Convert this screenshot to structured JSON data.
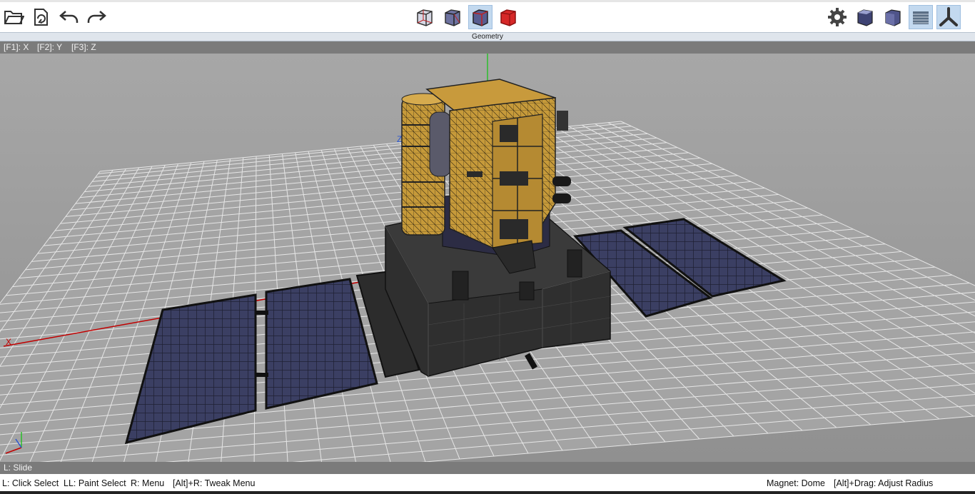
{
  "toolbar": {
    "left_tools": [
      {
        "name": "open-icon",
        "label": "Open"
      },
      {
        "name": "import-icon",
        "label": "Import"
      },
      {
        "name": "undo-icon",
        "label": "Undo"
      },
      {
        "name": "redo-icon",
        "label": "Redo"
      }
    ],
    "view_modes": [
      {
        "name": "wireframe-mode",
        "active": false
      },
      {
        "name": "wireframe-faces-mode",
        "active": false
      },
      {
        "name": "shaded-wireframe-mode",
        "active": true
      },
      {
        "name": "solid-mode",
        "active": false
      }
    ],
    "right_tools": [
      {
        "name": "settings-icon",
        "active": false
      },
      {
        "name": "cube-shaded-icon",
        "active": false
      },
      {
        "name": "cube-flat-icon",
        "active": false
      },
      {
        "name": "grid-plane-icon",
        "active": true
      },
      {
        "name": "axes-gizmo-icon",
        "active": true
      }
    ],
    "colors": {
      "accent": "#c3d9ef",
      "solid_red": "#d62828"
    }
  },
  "window": {
    "title": "Geometry"
  },
  "axis_hints": {
    "x": "[F1]: X",
    "y": "[F2]: Y",
    "z": "[F3]: Z"
  },
  "viewport": {
    "axis_labels": {
      "x": "X",
      "z": "Z"
    },
    "colors": {
      "background": "#9b9b9b",
      "grid": "#e6e6e6",
      "x_axis": "#c00000",
      "y_axis": "#2bbf2b",
      "z_axis": "#2a55d0",
      "gold": "#c8962e",
      "panel": "#3a3d5e"
    }
  },
  "slide_hint": "L: Slide",
  "status": {
    "click_select": "L: Click Select",
    "paint_select": "LL: Paint Select",
    "menu": "R: Menu",
    "tweak_menu": "[Alt]+R: Tweak Menu",
    "magnet": "Magnet: Dome",
    "adjust_radius": "[Alt]+Drag: Adjust Radius"
  }
}
